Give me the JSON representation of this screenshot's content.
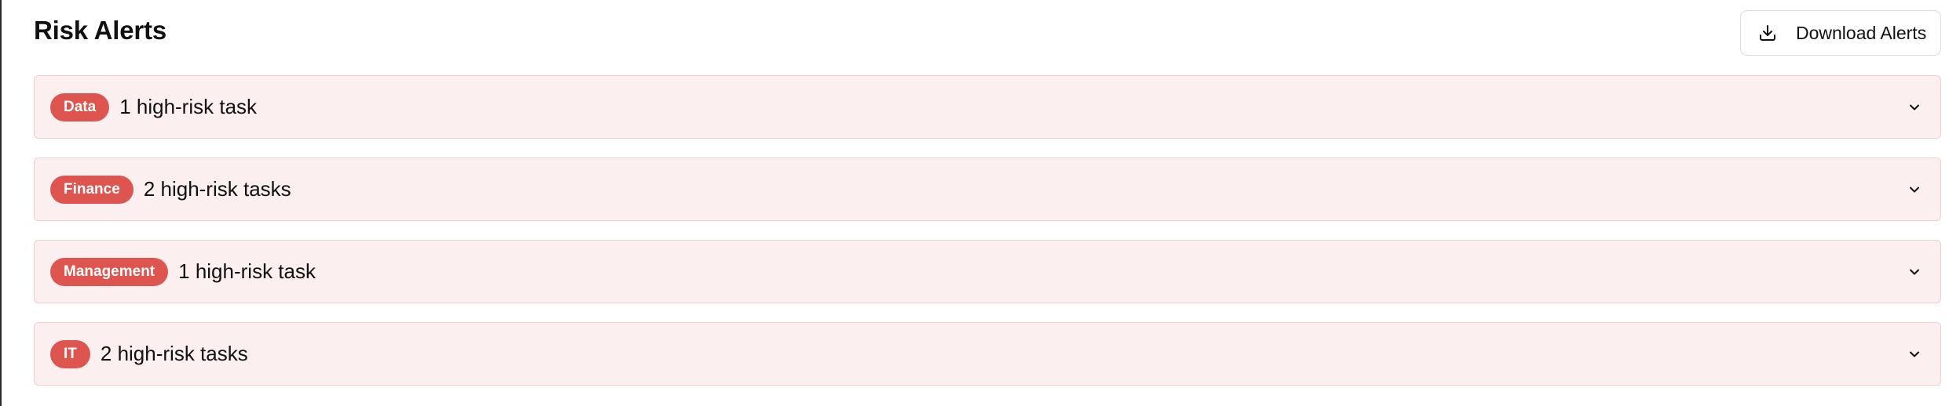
{
  "header": {
    "title": "Risk Alerts",
    "download_label": "Download Alerts",
    "download_icon": "download-icon"
  },
  "alerts": [
    {
      "category": "Data",
      "summary": "1 high-risk task",
      "icon": "chevron-down-icon"
    },
    {
      "category": "Finance",
      "summary": "2 high-risk tasks",
      "icon": "chevron-down-icon"
    },
    {
      "category": "Management",
      "summary": "1 high-risk task",
      "icon": "chevron-down-icon"
    },
    {
      "category": "IT",
      "summary": "2 high-risk tasks",
      "icon": "chevron-down-icon"
    }
  ],
  "colors": {
    "badge_bg": "#de5550",
    "row_bg": "#fcefef",
    "row_border": "#f3cccc"
  }
}
